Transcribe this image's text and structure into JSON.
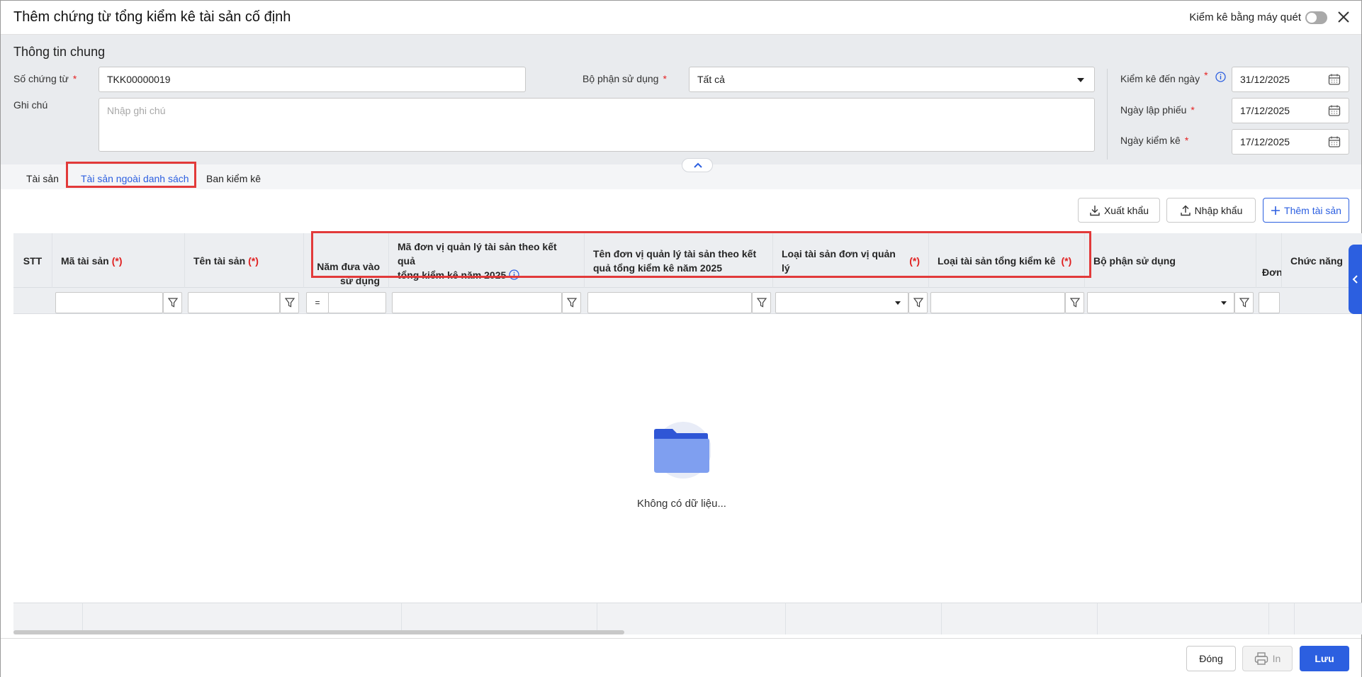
{
  "title": "Thêm chứng từ tổng kiểm kê tài sản cố định",
  "scan_toggle_label": "Kiểm kê bằng máy quét",
  "general": {
    "section_title": "Thông tin chung",
    "doc_no_label": "Số chứng từ",
    "doc_no_value": "TKK00000019",
    "dept_label": "Bộ phận sử dụng",
    "dept_value": "Tất cả",
    "note_label": "Ghi chú",
    "note_placeholder": "Nhập ghi chú",
    "inventory_to_label": "Kiểm kê đến ngày",
    "inventory_to_value": "31/12/2025",
    "created_date_label": "Ngày lập phiếu",
    "created_date_value": "17/12/2025",
    "check_date_label": "Ngày kiểm kê",
    "check_date_value": "17/12/2025",
    "required_mark": "*"
  },
  "tabs": [
    {
      "label": "Tài sản"
    },
    {
      "label": "Tài sản ngoài danh sách"
    },
    {
      "label": "Ban kiểm kê"
    }
  ],
  "toolbar": {
    "export_label": "Xuất khẩu",
    "import_label": "Nhập khẩu",
    "add_label": "Thêm tài sản"
  },
  "grid": {
    "required_tag": "(*)",
    "columns": {
      "stt": "STT",
      "asset_code": "Mã tài sản",
      "asset_name": "Tên tài sản",
      "year_line1": "Năm đưa vào",
      "year_line2": "sử dụng",
      "unit_code_line1": "Mã đơn vị quản lý tài sản theo kết quả",
      "unit_code_line2": "tổng kiểm kê năm 2025",
      "unit_name_line1": "Tên đơn vị quản lý tài sản theo kết",
      "unit_name_line2": "quả tổng kiểm kê năm 2025",
      "unit_asset_type": "Loại tài sản đơn vị quản lý",
      "inventory_asset_type": "Loại tài sản tổng kiểm kê",
      "department": "Bộ phận sử dụng",
      "partial": "Đơn",
      "actions": "Chức năng"
    },
    "year_operator": "=",
    "empty_text": "Không có dữ liệu..."
  },
  "footer": {
    "close_label": "Đóng",
    "print_label": "In",
    "save_label": "Lưu"
  },
  "colors": {
    "accent": "#2c5fe0",
    "required": "#e52222",
    "highlight": "#e23a3a",
    "header_bg": "#e9ebee"
  }
}
